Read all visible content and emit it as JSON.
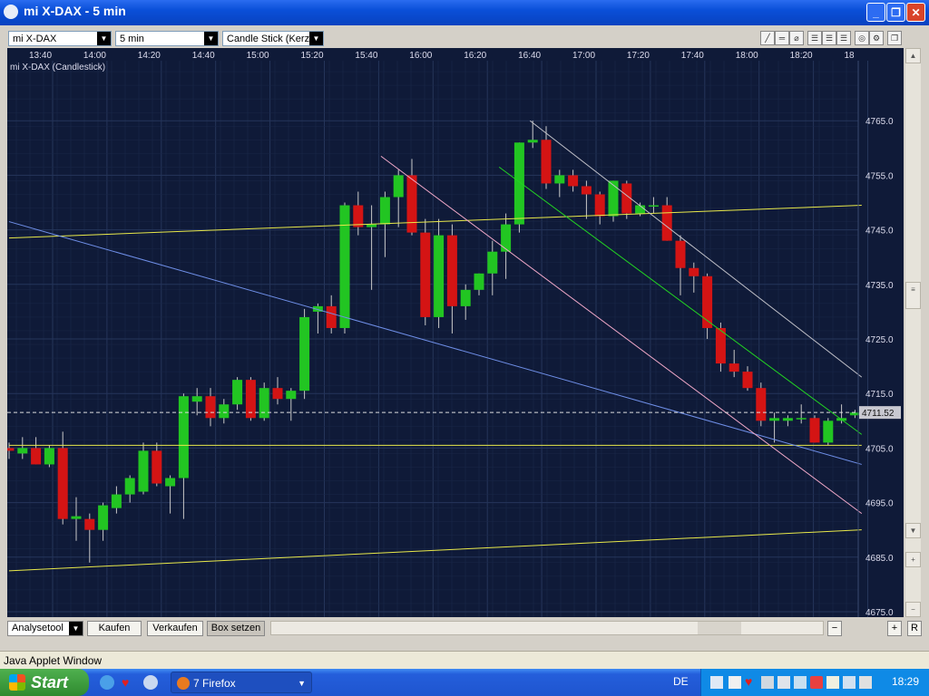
{
  "window": {
    "title": "mi X-DAX - 5 min"
  },
  "toolbar": {
    "instrument": "mi X-DAX",
    "interval": "5 min",
    "chart_style": "Candle Stick (Kerze"
  },
  "bottom": {
    "analysetool": "Analysetool",
    "kaufen": "Kaufen",
    "verkaufen": "Verkaufen",
    "box_setzen": "Box setzen",
    "r_label": "R"
  },
  "applet_status": "Java Applet Window",
  "taskbar": {
    "start_label": "Start",
    "task_label": "7 Firefox",
    "lang": "DE",
    "clock": "18:29"
  },
  "colors": {
    "background": "#0f1a38",
    "up": "#22c522",
    "down": "#d41414",
    "grid": "#2a3a60"
  },
  "chart_data": {
    "type": "candlestick",
    "title": "mi X-DAX (Candlestick)",
    "x_ticks": [
      "13:40",
      "14:00",
      "14:20",
      "14:40",
      "15:00",
      "15:20",
      "15:40",
      "16:00",
      "16:20",
      "16:40",
      "17:00",
      "17:20",
      "17:40",
      "18:00",
      "18:20",
      "18"
    ],
    "y_ticks": [
      "4675.0",
      "4685.0",
      "4695.0",
      "4705.0",
      "4715.0",
      "4725.0",
      "4735.0",
      "4745.0",
      "4755.0",
      "4765.0"
    ],
    "current_price": "4711.52",
    "ylim": [
      4674,
      4776
    ],
    "grid": true,
    "candles": [
      {
        "o": 4705.0,
        "h": 4706.0,
        "l": 4703.0,
        "c": 4704.5
      },
      {
        "o": 4704.0,
        "h": 4707.0,
        "l": 4703.0,
        "c": 4705.0
      },
      {
        "o": 4705.0,
        "h": 4707.0,
        "l": 4702.0,
        "c": 4702.0
      },
      {
        "o": 4702.0,
        "h": 4705.5,
        "l": 4701.5,
        "c": 4705.0
      },
      {
        "o": 4705.0,
        "h": 4708.0,
        "l": 4691.0,
        "c": 4692.0
      },
      {
        "o": 4692.0,
        "h": 4696.0,
        "l": 4688.0,
        "c": 4692.5
      },
      {
        "o": 4692.0,
        "h": 4693.0,
        "l": 4684.0,
        "c": 4690.0
      },
      {
        "o": 4690.0,
        "h": 4695.0,
        "l": 4688.0,
        "c": 4694.5
      },
      {
        "o": 4694.0,
        "h": 4698.0,
        "l": 4693.0,
        "c": 4696.5
      },
      {
        "o": 4696.5,
        "h": 4700.0,
        "l": 4695.0,
        "c": 4699.5
      },
      {
        "o": 4697.0,
        "h": 4706.0,
        "l": 4696.5,
        "c": 4704.5
      },
      {
        "o": 4704.5,
        "h": 4706.0,
        "l": 4698.0,
        "c": 4698.5
      },
      {
        "o": 4698.0,
        "h": 4700.0,
        "l": 4693.0,
        "c": 4699.5
      },
      {
        "o": 4699.5,
        "h": 4715.0,
        "l": 4692.0,
        "c": 4714.5
      },
      {
        "o": 4713.5,
        "h": 4716.0,
        "l": 4711.0,
        "c": 4714.5
      },
      {
        "o": 4714.5,
        "h": 4716.0,
        "l": 4709.0,
        "c": 4710.5
      },
      {
        "o": 4710.5,
        "h": 4714.0,
        "l": 4709.5,
        "c": 4713.0
      },
      {
        "o": 4713.0,
        "h": 4718.0,
        "l": 4712.0,
        "c": 4717.5
      },
      {
        "o": 4717.5,
        "h": 4718.0,
        "l": 4710.0,
        "c": 4710.5
      },
      {
        "o": 4710.5,
        "h": 4717.0,
        "l": 4710.0,
        "c": 4716.0
      },
      {
        "o": 4716.0,
        "h": 4718.0,
        "l": 4713.0,
        "c": 4714.0
      },
      {
        "o": 4714.0,
        "h": 4716.0,
        "l": 4710.0,
        "c": 4715.5
      },
      {
        "o": 4715.5,
        "h": 4730.5,
        "l": 4714.0,
        "c": 4729.0
      },
      {
        "o": 4730.0,
        "h": 4731.5,
        "l": 4726.0,
        "c": 4731.0
      },
      {
        "o": 4731.0,
        "h": 4733.0,
        "l": 4726.0,
        "c": 4727.0
      },
      {
        "o": 4727.0,
        "h": 4750.0,
        "l": 4726.0,
        "c": 4749.5
      },
      {
        "o": 4749.5,
        "h": 4752.0,
        "l": 4744.0,
        "c": 4745.5
      },
      {
        "o": 4745.5,
        "h": 4749.5,
        "l": 4734.0,
        "c": 4746.0
      },
      {
        "o": 4746.0,
        "h": 4752.0,
        "l": 4740.0,
        "c": 4751.0
      },
      {
        "o": 4751.0,
        "h": 4756.0,
        "l": 4745.5,
        "c": 4755.0
      },
      {
        "o": 4755.0,
        "h": 4758.0,
        "l": 4744.0,
        "c": 4744.5
      },
      {
        "o": 4744.5,
        "h": 4747.0,
        "l": 4727.5,
        "c": 4729.0
      },
      {
        "o": 4729.0,
        "h": 4747.0,
        "l": 4727.0,
        "c": 4744.0
      },
      {
        "o": 4744.0,
        "h": 4746.0,
        "l": 4726.0,
        "c": 4731.0
      },
      {
        "o": 4731.0,
        "h": 4735.0,
        "l": 4728.5,
        "c": 4734.0
      },
      {
        "o": 4734.0,
        "h": 4737.0,
        "l": 4733.0,
        "c": 4737.0
      },
      {
        "o": 4737.0,
        "h": 4743.0,
        "l": 4733.0,
        "c": 4741.0
      },
      {
        "o": 4741.0,
        "h": 4748.0,
        "l": 4736.0,
        "c": 4746.0
      },
      {
        "o": 4746.0,
        "h": 4761.0,
        "l": 4744.5,
        "c": 4761.0
      },
      {
        "o": 4761.0,
        "h": 4765.0,
        "l": 4760.0,
        "c": 4761.5
      },
      {
        "o": 4761.5,
        "h": 4764.0,
        "l": 4752.5,
        "c": 4753.5
      },
      {
        "o": 4753.5,
        "h": 4756.0,
        "l": 4751.0,
        "c": 4755.0
      },
      {
        "o": 4755.0,
        "h": 4756.0,
        "l": 4752.0,
        "c": 4753.0
      },
      {
        "o": 4753.0,
        "h": 4754.0,
        "l": 4747.0,
        "c": 4751.5
      },
      {
        "o": 4751.5,
        "h": 4752.0,
        "l": 4746.0,
        "c": 4747.5
      },
      {
        "o": 4747.5,
        "h": 4754.0,
        "l": 4746.5,
        "c": 4754.0
      },
      {
        "o": 4753.5,
        "h": 4754.0,
        "l": 4747.0,
        "c": 4748.0
      },
      {
        "o": 4748.0,
        "h": 4750.0,
        "l": 4747.5,
        "c": 4749.5
      },
      {
        "o": 4749.5,
        "h": 4751.0,
        "l": 4748.0,
        "c": 4749.5
      },
      {
        "o": 4749.5,
        "h": 4751.0,
        "l": 4743.0,
        "c": 4743.0
      },
      {
        "o": 4743.0,
        "h": 4744.0,
        "l": 4733.0,
        "c": 4738.0
      },
      {
        "o": 4738.0,
        "h": 4739.0,
        "l": 4733.5,
        "c": 4736.5
      },
      {
        "o": 4736.5,
        "h": 4737.0,
        "l": 4725.0,
        "c": 4727.0
      },
      {
        "o": 4727.0,
        "h": 4728.0,
        "l": 4719.0,
        "c": 4720.5
      },
      {
        "o": 4720.5,
        "h": 4723.0,
        "l": 4718.0,
        "c": 4719.0
      },
      {
        "o": 4719.0,
        "h": 4720.0,
        "l": 4715.5,
        "c": 4716.0
      },
      {
        "o": 4716.0,
        "h": 4717.0,
        "l": 4709.0,
        "c": 4710.0
      },
      {
        "o": 4710.0,
        "h": 4711.5,
        "l": 4706.0,
        "c": 4710.5
      },
      {
        "o": 4710.0,
        "h": 4711.0,
        "l": 4709.0,
        "c": 4710.5
      },
      {
        "o": 4710.5,
        "h": 4713.0,
        "l": 4709.5,
        "c": 4710.5
      },
      {
        "o": 4710.5,
        "h": 4711.0,
        "l": 4706.0,
        "c": 4706.0
      },
      {
        "o": 4706.0,
        "h": 4710.5,
        "l": 4705.5,
        "c": 4710.0
      },
      {
        "o": 4710.0,
        "h": 4713.0,
        "l": 4709.5,
        "c": 4710.5
      },
      {
        "o": 4711.0,
        "h": 4712.0,
        "l": 4710.5,
        "c": 4711.5
      }
    ],
    "lines": [
      {
        "color": "#e8e84a",
        "from": [
          0,
          4743.5
        ],
        "to": [
          63.5,
          4749.5
        ]
      },
      {
        "color": "#e8e84a",
        "from": [
          0,
          4705.5
        ],
        "to": [
          63.5,
          4705.5
        ]
      },
      {
        "color": "#e8e84a",
        "from": [
          0,
          4682.5
        ],
        "to": [
          63.5,
          4690.0
        ]
      },
      {
        "color": "#6f8fe8",
        "from": [
          0,
          4746.5
        ],
        "to": [
          63.5,
          4702.0
        ]
      },
      {
        "color": "#f0a8c8",
        "from": [
          27.7,
          4758.5
        ],
        "to": [
          63.5,
          4693.0
        ]
      },
      {
        "color": "#22d422",
        "from": [
          36.5,
          4756.5
        ],
        "to": [
          63.5,
          4707.5
        ]
      },
      {
        "color": "#c0c0c8",
        "from": [
          38.8,
          4765.0
        ],
        "to": [
          63.5,
          4718.0
        ]
      }
    ]
  }
}
